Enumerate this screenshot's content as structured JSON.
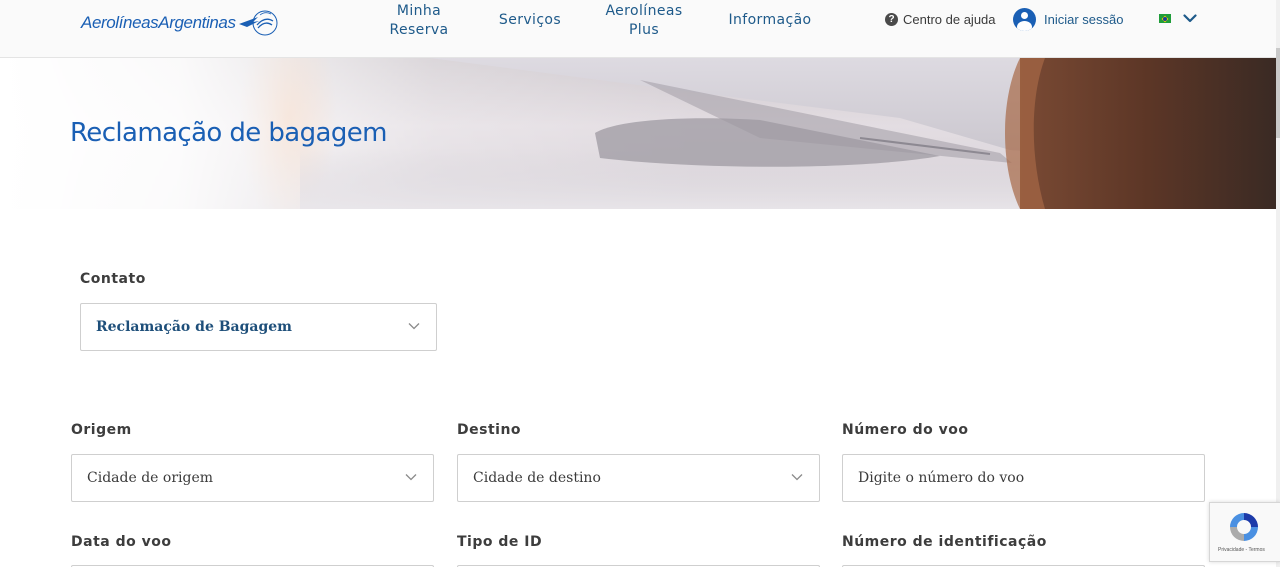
{
  "header": {
    "logo_text": "AerolíneasArgentinas",
    "nav": {
      "minha_reserva_line1": "Minha",
      "minha_reserva_line2": "Reserva",
      "servicos": "Serviços",
      "plus_line1": "Aerolíneas",
      "plus_line2": "Plus",
      "informacao": "Informação"
    },
    "help_label": "Centro de ajuda",
    "login_label": "Iniciar sessão",
    "language_flag": "brazil-flag"
  },
  "hero": {
    "title": "Reclamação de bagagem"
  },
  "form": {
    "contato": {
      "label": "Contato",
      "value": "Reclamação de Bagagem"
    },
    "origem": {
      "label": "Origem",
      "placeholder": "Cidade de origem"
    },
    "destino": {
      "label": "Destino",
      "placeholder": "Cidade de destino"
    },
    "numero_voo": {
      "label": "Número do voo",
      "placeholder": "Digite o número do voo"
    },
    "data_voo": {
      "label": "Data do voo"
    },
    "tipo_id": {
      "label": "Tipo de ID"
    },
    "numero_identificacao": {
      "label": "Número de identificação"
    }
  },
  "recaptcha": {
    "footer": "Privacidade - Termos"
  },
  "colors": {
    "brand_blue": "#1a5fb4",
    "nav_blue": "#1e5a8a"
  }
}
